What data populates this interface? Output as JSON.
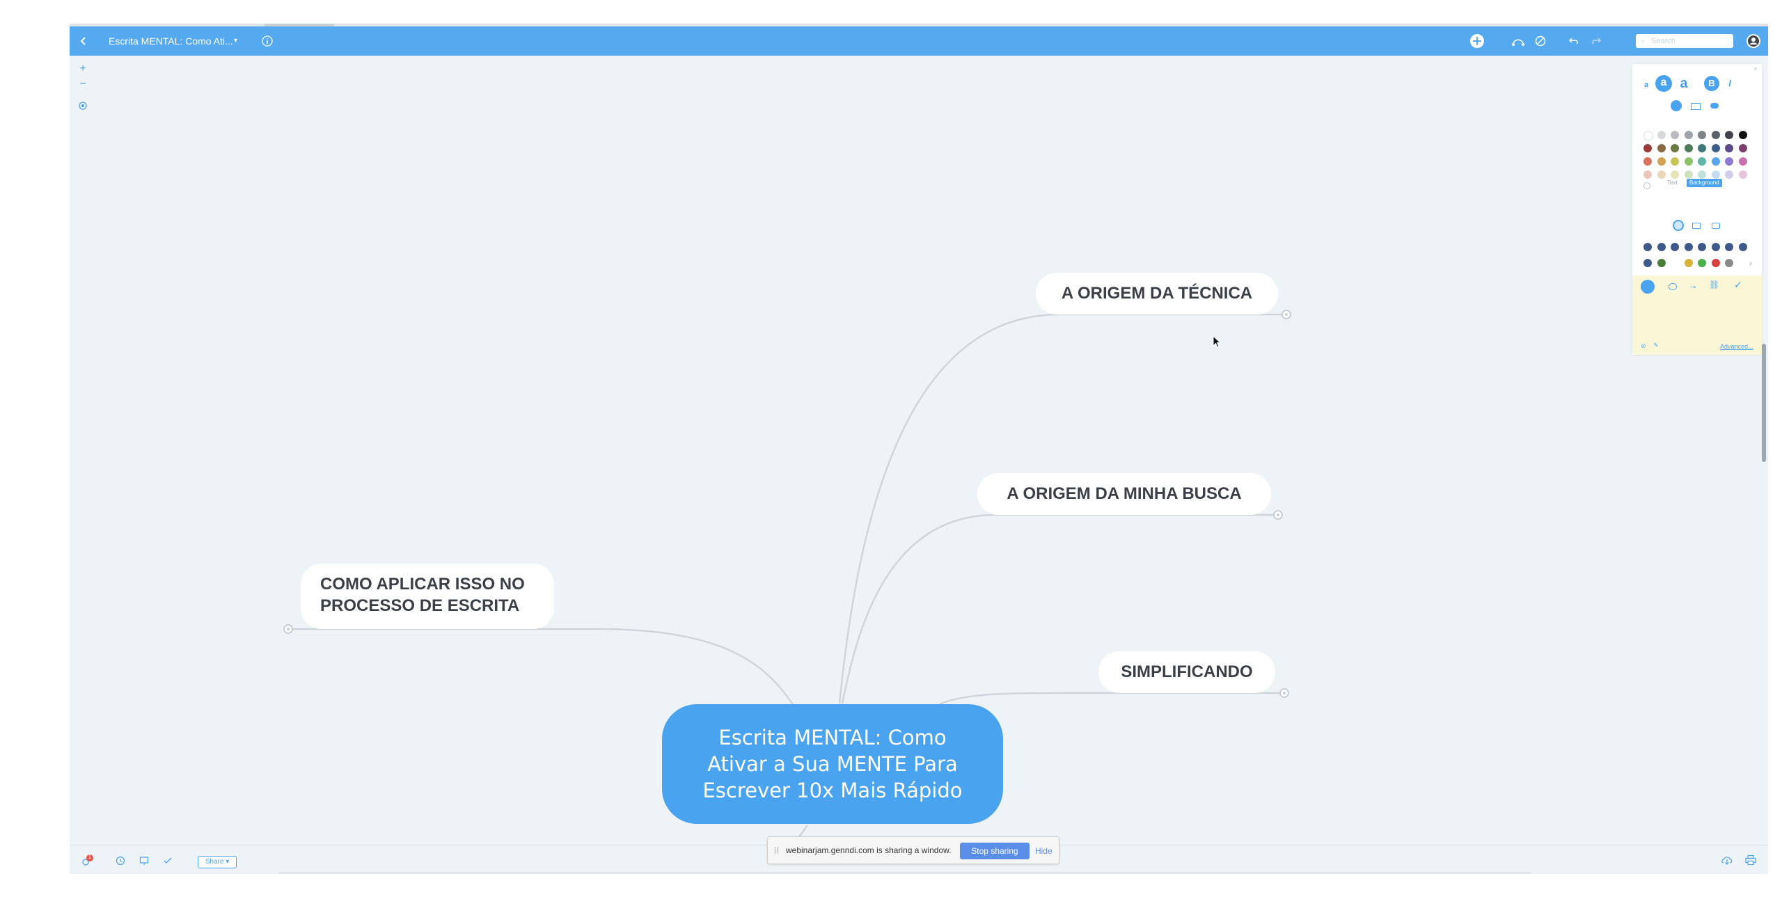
{
  "app": {
    "title": "Escrita MENTAL: Como Ati...",
    "title_caret": "▾",
    "search_placeholder": "Search"
  },
  "toolbar_icons": [
    "back-icon",
    "info-icon",
    "add-icon",
    "share-topic-icon",
    "no-entry-icon",
    "undo-icon",
    "redo-icon",
    "user-avatar"
  ],
  "zoom": {
    "plus": "+",
    "minus": "−"
  },
  "mindmap": {
    "root": "Escrita MENTAL: Como Ativar a Sua MENTE Para Escrever 10x Mais Rápido",
    "topics": [
      {
        "id": "origem-tecnica",
        "label": "A ORIGEM DA TÉCNICA"
      },
      {
        "id": "origem-busca",
        "label": "A ORIGEM DA MINHA BUSCA"
      },
      {
        "id": "simplificando",
        "label": "SIMPLIFICANDO"
      },
      {
        "id": "como-aplicar",
        "label_lines": [
          "COMO APLICAR ISSO NO",
          "PROCESSO DE ESCRITA"
        ]
      }
    ]
  },
  "format_panel": {
    "font_sizes": [
      "a",
      "a",
      "a"
    ],
    "bold": "B",
    "italic": "I",
    "text_tab": "Text",
    "background_tab": "Background",
    "advanced_link": "Advanced...",
    "palette": [
      [
        "#ffffff",
        "#d6d9dc",
        "#b9bdc2",
        "#9ea3a9",
        "#7d8389",
        "#5c6269",
        "#3f454b",
        "#111111"
      ],
      [
        "#9c3b36",
        "#8a6a44",
        "#6b7a3e",
        "#4c7d58",
        "#3d7b7b",
        "#3c5f8a",
        "#5a4a86",
        "#7a3f6a"
      ],
      [
        "#d9735d",
        "#d4a257",
        "#c6c455",
        "#8fc26a",
        "#5fb7a7",
        "#57a4e6",
        "#8d7ad0",
        "#c873b0"
      ],
      [
        "#ebc6bb",
        "#ead6b8",
        "#e7e3b9",
        "#cfe2bf",
        "#c1e1da",
        "#c2dcf2",
        "#d3ccea",
        "#e8c4dc"
      ]
    ],
    "badge_colors": [
      "#3f5a8a",
      "#4a7d3a",
      "#d8b43a",
      "#4ab04a",
      "#d94040",
      "#8a8a8a"
    ],
    "icons_row2_count": 8
  },
  "bottom": {
    "notification_count": "1",
    "share_label": "Share ▾"
  },
  "screen_share": {
    "message": "webinarjam.genndi.com is sharing a window.",
    "stop_label": "Stop sharing",
    "hide_label": "Hide"
  },
  "colors": {
    "accent": "#55a9ef",
    "canvas": "#eef3f7",
    "root_node": "#4aa3ee",
    "topic_text": "#3a3f48",
    "connector": "#cfd5db"
  }
}
